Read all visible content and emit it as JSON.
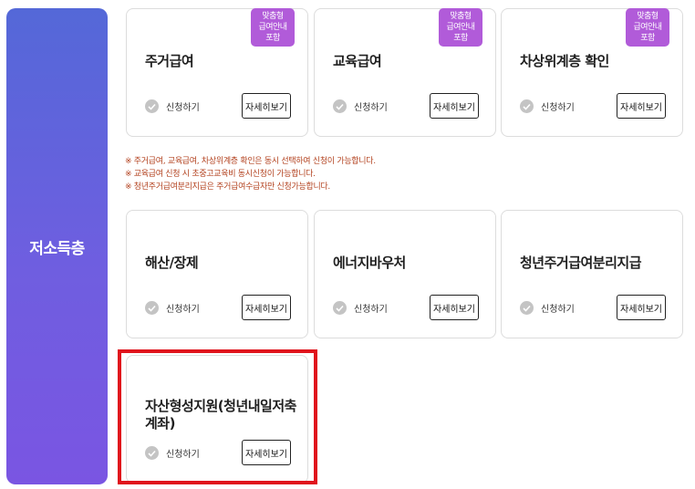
{
  "category": {
    "label": "저소득층"
  },
  "badge": {
    "line1": "맞춤형",
    "line2": "급여안내",
    "line3": "포함"
  },
  "apply_label": "신청하기",
  "detail_label": "자세히보기",
  "row1": [
    {
      "title": "주거급여",
      "badge": true
    },
    {
      "title": "교육급여",
      "badge": true
    },
    {
      "title": "차상위계층 확인",
      "badge": true
    }
  ],
  "notes": [
    "※ 주거급여, 교육급여, 차상위계층 확인은 동시 선택하여 신청이 가능합니다.",
    "※ 교육급여 신청 시 초중고교육비 동시신청이 가능합니다.",
    "※ 청년주거급여분리지급은 주거급여수급자만 신청가능합니다."
  ],
  "row2": [
    {
      "title": "해산/장제"
    },
    {
      "title": "에너지바우처"
    },
    {
      "title": "청년주거급여분리지급"
    }
  ],
  "row3": [
    {
      "title": "자산형성지원(청년내일저축계좌)"
    }
  ]
}
